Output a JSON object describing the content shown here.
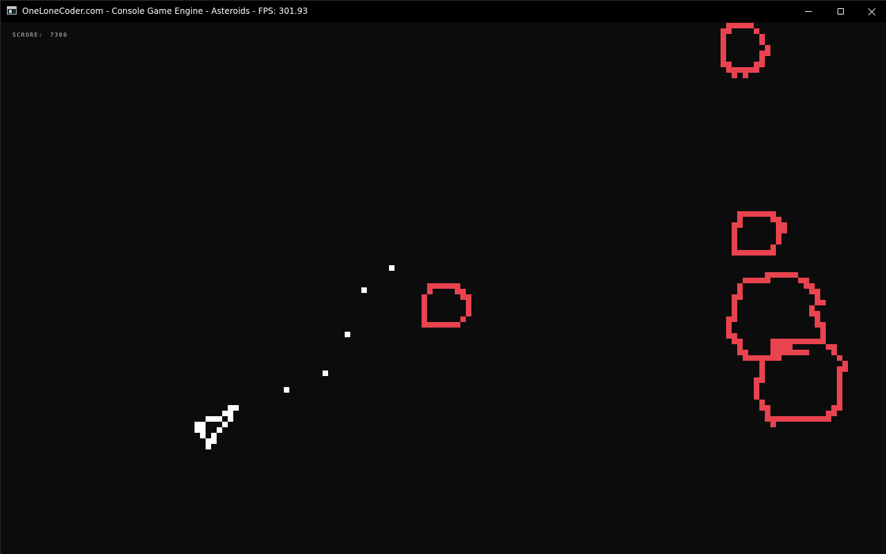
{
  "window": {
    "title": "OneLoneCoder.com - Console Game Engine - Asteroids - FPS: 301.93",
    "controls": {
      "minimize": "minimize",
      "maximize": "maximize",
      "close": "close"
    }
  },
  "hud": {
    "score_label": "SCRORE:",
    "score_value": "7300"
  },
  "colors": {
    "background": "#0c0c0c",
    "asteroid": "#e8434f",
    "ship": "#ffffff",
    "bullet": "#ffffff",
    "titlebar": "#000000"
  },
  "game": {
    "asteroid_count": 5,
    "bullet_count": 5,
    "player_ship": "ship-icon"
  }
}
